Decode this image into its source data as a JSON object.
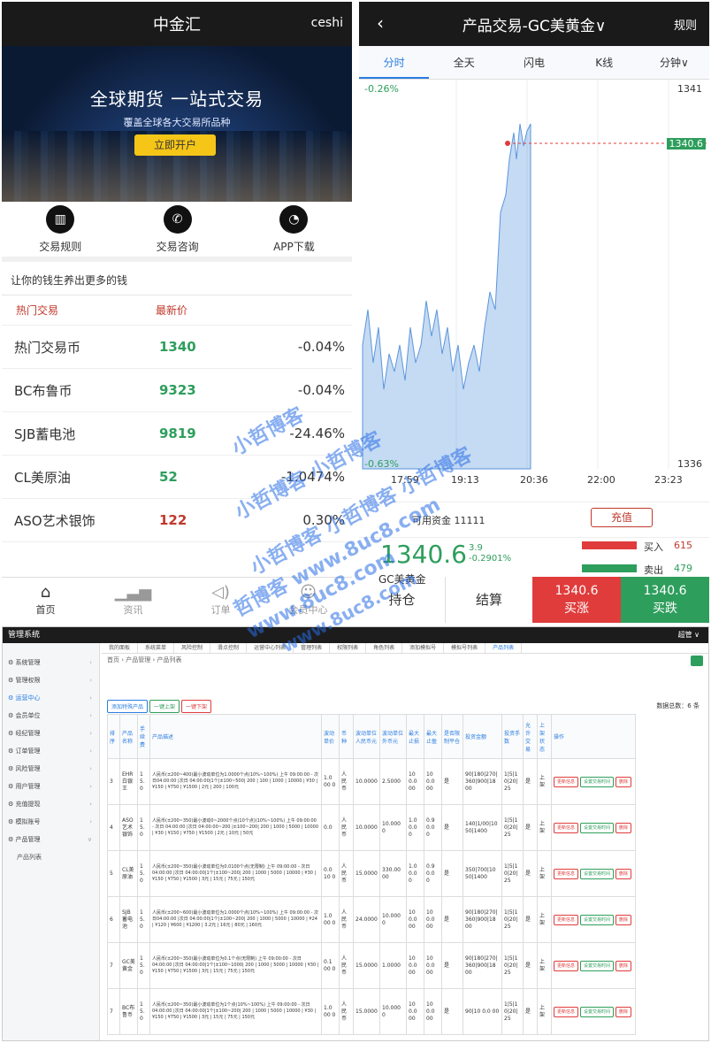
{
  "left_app": {
    "header": {
      "title": "中金汇",
      "user": "ceshi"
    },
    "banner": {
      "title": "全球期货 一站式交易",
      "subtitle": "覆盖全球各大交易所品种",
      "cta": "立即开户"
    },
    "quick_links": [
      {
        "label": "交易规则",
        "icon": "chart-icon"
      },
      {
        "label": "交易咨询",
        "icon": "phone-icon"
      },
      {
        "label": "APP下载",
        "icon": "chat-icon"
      }
    ],
    "slogan": "让你的钱生养出更多的钱",
    "market_header": {
      "col1": "热门交易",
      "col2": "最新价"
    },
    "market": [
      {
        "name": "热门交易币",
        "price": "1340",
        "change": "-0.04%",
        "dir": "up"
      },
      {
        "name": "BC布鲁币",
        "price": "9323",
        "change": "-0.04%",
        "dir": "up"
      },
      {
        "name": "SJB蓄电池",
        "price": "9819",
        "change": "-24.46%",
        "dir": "up"
      },
      {
        "name": "CL美原油",
        "price": "52",
        "change": "-1.0474%",
        "dir": "up"
      },
      {
        "name": "ASO艺术银饰",
        "price": "122",
        "change": "0.30%",
        "dir": "down"
      }
    ],
    "tabbar": [
      {
        "label": "首页",
        "icon": "home-icon"
      },
      {
        "label": "资讯",
        "icon": "chart-icon"
      },
      {
        "label": "订单",
        "icon": "speaker-icon"
      },
      {
        "label": "会员中心",
        "icon": "user-icon"
      }
    ]
  },
  "right_app": {
    "header": {
      "back": "‹",
      "title": "产品交易-GC美黄金∨",
      "rules": "规则"
    },
    "tabs": [
      "分时",
      "全天",
      "闪电",
      "K线",
      "分钟∨"
    ],
    "chart": {
      "change_label": "-0.26%",
      "y_high": "1341",
      "y_low": "1336",
      "current_tag": "1340.6",
      "low_pct": "-0.63%",
      "x_ticks": [
        "17:59",
        "19:13",
        "20:36",
        "22:00",
        "23:23"
      ]
    },
    "account": {
      "balance_label": "可用资金",
      "balance": "11111",
      "recharge": "充值"
    },
    "quote": {
      "price": "1340.6",
      "delta": "3.9",
      "delta_pct": "-0.2901%",
      "name": "GC美黄金",
      "buy_label": "买入",
      "buy_count": "615",
      "sell_label": "卖出",
      "sell_count": "479"
    },
    "trade": {
      "hold": "持仓",
      "settle": "结算",
      "buy_up_price": "1340.6",
      "buy_up": "买涨",
      "buy_down_price": "1340.6",
      "buy_down": "买跌"
    }
  },
  "admin": {
    "title": "管理系统",
    "user": "超管 ∨",
    "sidebar": [
      "系统管理",
      "管理权限",
      "运营中心",
      "会员单位",
      "经纪管理",
      "订单管理",
      "风险管理",
      "用户管理",
      "充值提现",
      "模拟账号",
      "产品管理",
      "产品列表"
    ],
    "tabs": [
      "我的面板",
      "系统菜单",
      "风险控制",
      "滑点控制",
      "运营中心列表",
      "管理列表",
      "权限列表",
      "角色列表",
      "添加模拟号",
      "模拟号列表",
      "产品列表"
    ],
    "breadcrumb": "首页 › 产品管理 › 产品列表",
    "actions": {
      "add": "添加特殊产品",
      "on": "一键上架",
      "off": "一键下架"
    },
    "total": "数据总数：6 条",
    "columns": [
      "排序",
      "产品名称",
      "手续费",
      "产品描述",
      "波动单价",
      "币种",
      "波动单位人民币元",
      "波动单位外币元",
      "最大止损",
      "最大止盈",
      "是否限制平仓",
      "投资金额",
      "投资手数",
      "允许交易",
      "上架状态",
      "操作"
    ],
    "rows": [
      {
        "sort": "3",
        "name": "EHR白银王",
        "fee": "1 5. 0",
        "desc": "人民币(±200~400)最小波动单位为1.0000个点(10%~100%) 上午 09:00:00 - 次日04:00:00 |次日 04:00:00|1个|±100~500| 200 | 100 | 1000 | 10000 | ¥30 | ¥150 | ¥750 | ¥1500 | 2元 | 200 | 100元",
        "unit": "1.0 00 0",
        "cur": "人民币",
        "rmb": "10.0000",
        "fx": "2.5000",
        "sl": "10 0.0 00",
        "tp": "10 0.0 00",
        "limit": "是",
        "invest": "90|180|270| 360|900|18 00",
        "lots": "1|5|1 0|20| 25",
        "allow": "是",
        "status": "上架"
      },
      {
        "sort": "4",
        "name": "ASO艺术银饰",
        "fee": "1 5. 0",
        "desc": "人民币(±200~350)最小波动0~2000个点(10个点)(10%~100%) 上午 09:00:00 - 次日 04:00:00 |次日 04:00:00~200 |±100~200| 200 | 1000 | 5000 | 10000 | ¥30 | ¥150 | ¥750 | ¥1500 | 2元 | 10元 | 50元",
        "unit": "0.0",
        "cur": "人民币",
        "rmb": "10.0000",
        "fx": "10.000 0",
        "sl": "1.0 0.0 0",
        "tp": "0.9 0.0 0",
        "limit": "是",
        "invest": "140|1/00|10 50|1400",
        "lots": "1|5|1 0|20| 25",
        "allow": "是",
        "status": "上架"
      },
      {
        "sort": "5",
        "name": "CL美原油",
        "fee": "1 5. 0",
        "desc": "人民币(±200~350)最小波动单位为0.0100个点(无限制) 上午 09:00:00 - 次日04:00:00 |次日 04:00:00|1个|±100~200| 200 | 1000 | 5000 | 10000 | ¥30 | ¥150 | ¥750 | ¥1500 | 3元 | 15元 | 75元 | 150元",
        "unit": "0.0 10 0",
        "cur": "人民币",
        "rmb": "15.0000",
        "fx": "330.00 00",
        "sl": "1.0 0.0 0",
        "tp": "0.9 0.0 0",
        "limit": "是",
        "invest": "350|700|10 50|1400",
        "lots": "1|5|1 0|20| 25",
        "allow": "是",
        "status": "上架"
      },
      {
        "sort": "6",
        "name": "SJB蓄电池",
        "fee": "1 5. 0",
        "desc": "人民币(±200~600)最小波动单位为1.0000个点(10%~100%) 上午 09:00:00 - 次日04:00:00 |次日 04:00:00|1个|±100~200| 200 | 1000 | 5000 | 10000 | ¥24 | ¥120 | ¥600 | ¥1200 | 3.2元 | 16元 | 80元 | 160元",
        "unit": "1.0 00 0",
        "cur": "人民币",
        "rmb": "24.0000",
        "fx": "10.000 0",
        "sl": "10 0.0 00",
        "tp": "10 0.0 00",
        "limit": "是",
        "invest": "90|180|270| 360|900|18 00",
        "lots": "1|5|1 0|20| 25",
        "allow": "是",
        "status": "上架"
      },
      {
        "sort": "7",
        "name": "GC美黄金",
        "fee": "1 5. 0",
        "desc": "人民币(±200~350)最小波动单位为0.1个点(无限制) 上午 09:00:00 - 次日04:00:00 |次日 04:00:00|1个|±100~1000| 200 | 1000 | 5000 | 10000 | ¥30 | ¥150 | ¥750 | ¥1500 | 3元 | 15元 | 75元 | 150元",
        "unit": "0.1 00 0",
        "cur": "人民币",
        "rmb": "15.0000",
        "fx": "1.0000",
        "sl": "10 0.0 00",
        "tp": "10 0.0 00",
        "limit": "是",
        "invest": "90|180|270| 360|900|18 00",
        "lots": "1|5|1 0|20| 25",
        "allow": "是",
        "status": "上架"
      },
      {
        "sort": "7",
        "name": "BC布鲁币",
        "fee": "1 5. 0",
        "desc": "人民币(±200~350)最小波动单位为1个点(10%~100%) 上午 09:00:00 - 次日04:00:00 |次日 04:00:00|1个|±100~200| 200 | 1000 | 5000 | 10000 | ¥30 | ¥150 | ¥750 | ¥1500 | 3元 | 15元 | 75元 | 150元",
        "unit": "1.0 00 0",
        "cur": "人民币",
        "rmb": "15.0000",
        "fx": "10.000 0",
        "sl": "10 0.0 00",
        "tp": "10 0.0 00",
        "limit": "是",
        "invest": "90|10 0.0 00",
        "lots": "1|5|1 0|20| 25",
        "allow": "是",
        "status": "上架"
      }
    ],
    "row_actions": {
      "edit": "更新信息",
      "time": "设置交易时间",
      "del": "删除"
    }
  },
  "watermark": [
    "小哲博客",
    "小哲博客 小哲博客",
    "小哲博客 小哲博客 小哲博客",
    "哲博客 www.8uc8.com",
    "www.8uc8.com",
    "www.8uc8.com"
  ]
}
